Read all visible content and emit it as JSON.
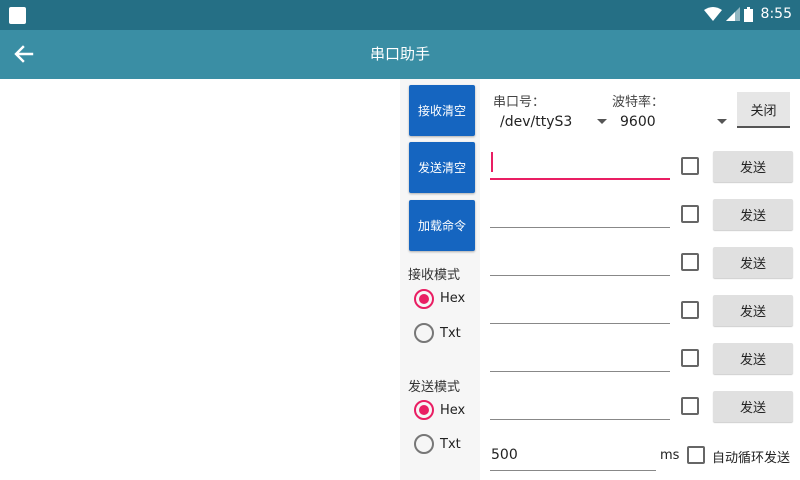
{
  "status_bar": {
    "time": "8:55",
    "background": "#256f85"
  },
  "app_bar": {
    "title": "串口助手",
    "background": "#3a8ea4",
    "back_icon": "arrow-left-icon"
  },
  "left_buttons": [
    {
      "label": "接收清空"
    },
    {
      "label": "发送清空"
    },
    {
      "label": "加载命令"
    }
  ],
  "receive_mode": {
    "label": "接收模式",
    "options": [
      {
        "label": "Hex",
        "checked": true
      },
      {
        "label": "Txt",
        "checked": false
      }
    ]
  },
  "send_mode": {
    "label": "发送模式",
    "options": [
      {
        "label": "Hex",
        "checked": true
      },
      {
        "label": "Txt",
        "checked": false
      }
    ]
  },
  "serial": {
    "port_label": "串口号：",
    "port_value": "/dev/ttyS3",
    "baud_label": "波特率：",
    "baud_value": "9600",
    "close_label": "关闭"
  },
  "command_rows": [
    {
      "value": "",
      "checked": false,
      "send_label": "发送",
      "focused": true
    },
    {
      "value": "",
      "checked": false,
      "send_label": "发送",
      "focused": false
    },
    {
      "value": "",
      "checked": false,
      "send_label": "发送",
      "focused": false
    },
    {
      "value": "",
      "checked": false,
      "send_label": "发送",
      "focused": false
    },
    {
      "value": "",
      "checked": false,
      "send_label": "发送",
      "focused": false
    },
    {
      "value": "",
      "checked": false,
      "send_label": "发送",
      "focused": false
    }
  ],
  "auto_send": {
    "interval_value": "500",
    "unit": "ms",
    "checked": false,
    "label": "自动循环发送"
  },
  "colors": {
    "accent": "#e91e63",
    "button_blue": "#1565c0"
  }
}
